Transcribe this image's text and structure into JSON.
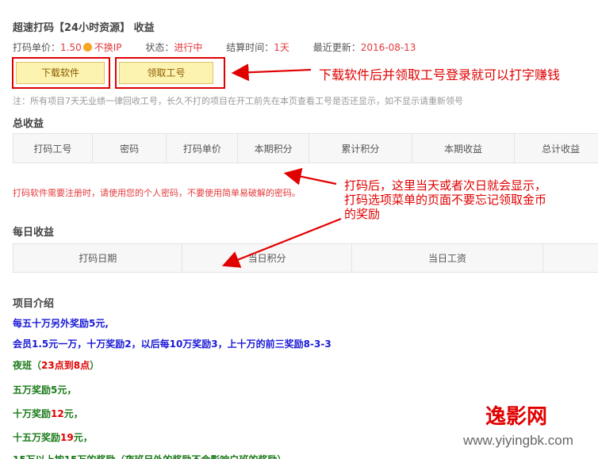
{
  "header": {
    "title": "超速打码【24小时资源】 收益"
  },
  "meta": {
    "price_label": "打码单价：",
    "price_value": "1.50",
    "no_ip": "不换IP",
    "status_label": "状态：",
    "status_value": "进行中",
    "settle_label": "结算时间：",
    "settle_value": "1天",
    "updated_label": "最近更新：",
    "updated_value": "2016-08-13"
  },
  "buttons": {
    "download": "下载软件",
    "get_id": "领取工号"
  },
  "annotations": {
    "top": "下载软件后并领取工号登录就可以打字赚钱",
    "middle_1": "打码后，这里当天或者次日就会显示，",
    "middle_2": "打码选项菜单的页面不要忘记领取金币",
    "middle_3": "的奖励"
  },
  "note": "注：所有项目7天无业绩一律回收工号，长久不打的项目在开工前先在本页查看工号是否还显示，如不显示请重新领号",
  "total": {
    "title": "总收益",
    "columns": [
      "打码工号",
      "密码",
      "打码单价",
      "本期积分",
      "累计积分",
      "本期收益",
      "总计收益"
    ]
  },
  "warning": "打码软件需要注册时，请使用您的个人密码，不要使用简单易破解的密码。",
  "daily": {
    "title": "每日收益",
    "columns": [
      "打码日期",
      "当日积分",
      "当日工资",
      ""
    ]
  },
  "intro": {
    "title": "项目介绍",
    "line1": "每五十万另外奖励5元,",
    "line2": "会员1.5元一万，十万奖励2，以后每10万奖励3，上十万的前三奖励8-3-3",
    "night_label": "夜班（",
    "night_time": "23点到8点",
    "night_end": "）",
    "r1_a": "五万奖励5元，",
    "r2_a": "十万奖励",
    "r2_b": "12",
    "r2_c": "元，",
    "r3_a": "十五万奖励",
    "r3_b": "19",
    "r3_c": "元，",
    "r4": "15万以上按15万的奖励（夜班另外的奖励不会影响白班的奖励）"
  },
  "watermark": {
    "name": "逸影网",
    "url": "www.yiyingbk.com"
  },
  "colors": {
    "accent_red": "#e10000",
    "button_fill": "#fdf3b0",
    "link_blue": "#1a1ad6",
    "green": "#1a7a1a"
  }
}
